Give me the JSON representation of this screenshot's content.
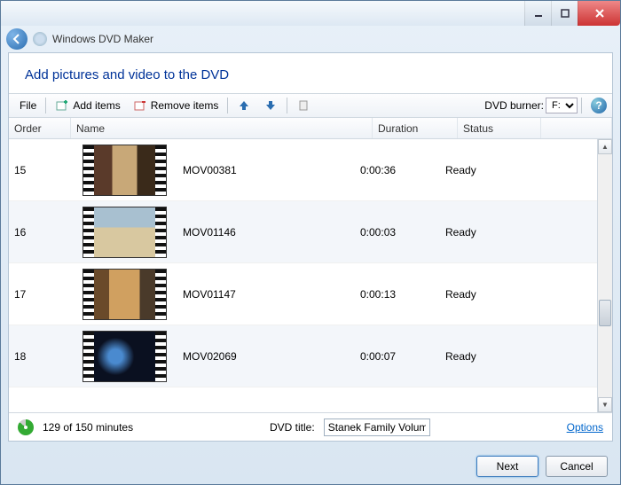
{
  "app_title": "Windows DVD Maker",
  "page_title": "Add pictures and video to the DVD",
  "toolbar": {
    "file": "File",
    "add_items": "Add items",
    "remove_items": "Remove items",
    "dvd_burner_label": "DVD burner:",
    "dvd_burner_value": "F:"
  },
  "columns": {
    "order": "Order",
    "name": "Name",
    "duration": "Duration",
    "status": "Status"
  },
  "items": [
    {
      "order": "15",
      "name": "MOV00381",
      "duration": "0:00:36",
      "status": "Ready"
    },
    {
      "order": "16",
      "name": "MOV01146",
      "duration": "0:00:03",
      "status": "Ready"
    },
    {
      "order": "17",
      "name": "MOV01147",
      "duration": "0:00:13",
      "status": "Ready"
    },
    {
      "order": "18",
      "name": "MOV02069",
      "duration": "0:00:07",
      "status": "Ready"
    }
  ],
  "footer": {
    "usage": "129 of 150 minutes",
    "dvd_title_label": "DVD title:",
    "dvd_title_value": "Stanek Family Volum",
    "options": "Options"
  },
  "buttons": {
    "next": "Next",
    "cancel": "Cancel"
  }
}
